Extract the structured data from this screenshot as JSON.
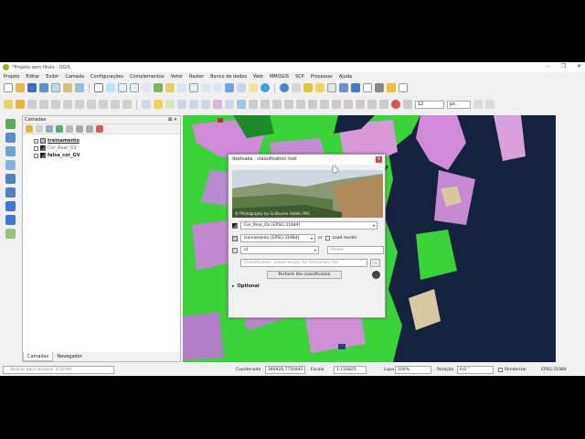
{
  "window": {
    "title": "*Projeto sem título - QGIS",
    "controls": [
      "–",
      "❐",
      "✕"
    ]
  },
  "menu": [
    "Projeto",
    "Editar",
    "Exibir",
    "Camada",
    "Configurações",
    "Complementos",
    "Vetor",
    "Raster",
    "Banco de dados",
    "Web",
    "MMQGIS",
    "SCP",
    "Processar",
    "Ajuda"
  ],
  "toolbar": {
    "size_value": "12",
    "size_unit": "px"
  },
  "layers_panel": {
    "title": "Camadas",
    "close": "⊠ ✕",
    "layers": [
      {
        "name": "treinamento",
        "checked": "✓",
        "style": "bold",
        "underline": true
      },
      {
        "name": "Cor_Real_GV",
        "checked": "",
        "style": "italic",
        "underline": false
      },
      {
        "name": "falsa_cor_GV",
        "checked": "✓",
        "style": "bold",
        "underline": false
      }
    ],
    "tabs": [
      "Camadas",
      "Navegador"
    ]
  },
  "dialog": {
    "title": "dzetsaka : classification tool",
    "close": "✕",
    "banner_credit": "© Photography by Guillaume Faddé, PAS",
    "raster_combo": "Cor_Real_GV [EPSG:31984]",
    "vector_combo": "treinamento [EPSG:31984]",
    "or_label": "or",
    "load_model_label": "Load model",
    "field_combo": "id",
    "model_placeholder": "Model",
    "output_placeholder": "Classification. Leave empty for temporary file",
    "browse_label": "...",
    "perform_label": "Perform the classification",
    "optional_label": "Optional"
  },
  "statusbar": {
    "locator_placeholder": "Buscar para localizar (Ctrl+K)",
    "coordinate_label": "Coordenada",
    "coordinate_value": "346926,7750442",
    "scale_label": "Escala",
    "scale_value": "1:116825",
    "magnifier_label": "Lupa",
    "magnifier_value": "100%",
    "rotation_label": "Rotação",
    "rotation_value": "0,0 °",
    "render_label": "Renderizar",
    "crs_label": "EPSG:31984"
  },
  "colors": {
    "water": "#15223e",
    "vegetation": "#3ad43a",
    "urban": "#d08ad8",
    "sand": "#d8c8a0",
    "qgis_green": "#93b023"
  }
}
